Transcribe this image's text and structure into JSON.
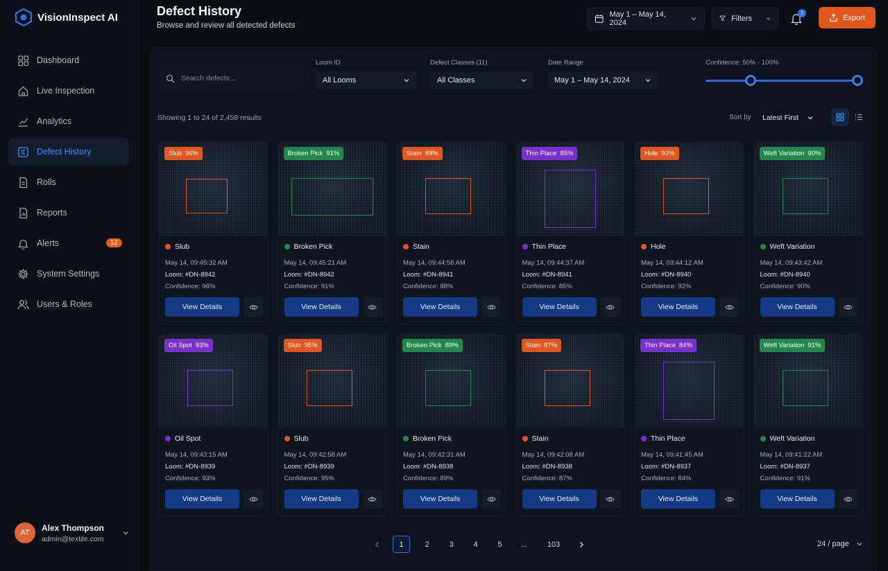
{
  "app": {
    "name": "VisionInspect AI"
  },
  "nav": [
    {
      "label": "Dashboard",
      "icon": "grid-icon"
    },
    {
      "label": "Live Inspection",
      "icon": "home-icon"
    },
    {
      "label": "Analytics",
      "icon": "chart-icon"
    },
    {
      "label": "Defect History",
      "icon": "defect-history-icon",
      "active": true
    },
    {
      "label": "Rolls",
      "icon": "document-icon"
    },
    {
      "label": "Reports",
      "icon": "report-icon"
    },
    {
      "label": "Alerts",
      "icon": "bell-icon",
      "badge": "12"
    },
    {
      "label": "System Settings",
      "icon": "gear-icon"
    },
    {
      "label": "Users & Roles",
      "icon": "users-icon"
    }
  ],
  "user": {
    "initials": "AT",
    "name": "Alex Thompson",
    "email": "admin@textile.com"
  },
  "header": {
    "title": "Defect History",
    "subtitle": "Browse and review all detected defects",
    "date_range": "May 1 – May 14, 2024",
    "filters_label": "Filters",
    "notification_count": "2",
    "export_label": "Export"
  },
  "filters": {
    "search_placeholder": "Search defects...",
    "loom_label": "Loom ID",
    "loom_value": "All Looms",
    "classes_label": "Defect Classes (11)",
    "classes_value": "All Classes",
    "date_label": "Date Range",
    "date_value": "May 1 – May 14, 2024",
    "confidence_label": "Confidence: 50% - 100%",
    "confidence_min": 50,
    "confidence_max": 100
  },
  "results": {
    "showing": "Showing 1 to 24 of 2,458 results",
    "sort_label": "Sort by",
    "sort_value": "Latest First"
  },
  "colors": {
    "orange": "#e5561f",
    "green": "#1f8a4a",
    "purple": "#7b2fd1",
    "accent": "#2f6fe3"
  },
  "cards": [
    {
      "tag": "Slub",
      "pct": "96%",
      "name": "Slub",
      "time": "May 14, 09:45:32 AM",
      "loom": "Loom: #DN-8942",
      "confidence": "Confidence: 96%",
      "color": "orange",
      "box": "small",
      "view": "View Details"
    },
    {
      "tag": "Broken Pick",
      "pct": "91%",
      "name": "Broken Pick",
      "time": "May 14, 09:45:21 AM",
      "loom": "Loom: #DN-8942",
      "confidence": "Confidence: 91%",
      "color": "green",
      "box": "wide",
      "view": "View Details"
    },
    {
      "tag": "Stain",
      "pct": "88%",
      "name": "Stain",
      "time": "May 14, 09:44:58 AM",
      "loom": "Loom: #DN-8941",
      "confidence": "Confidence: 88%",
      "color": "orange",
      "box": "medium",
      "view": "View Details"
    },
    {
      "tag": "Thin Place",
      "pct": "85%",
      "name": "Thin Place",
      "time": "May 14, 09:44:37 AM",
      "loom": "Loom: #DN-8941",
      "confidence": "Confidence: 85%",
      "color": "purple",
      "box": "tall",
      "view": "View Details"
    },
    {
      "tag": "Hole",
      "pct": "92%",
      "name": "Hole",
      "time": "May 14, 09:44:12 AM",
      "loom": "Loom: #DN-8940",
      "confidence": "Confidence: 92%",
      "color": "orange",
      "box": "medium",
      "view": "View Details"
    },
    {
      "tag": "Weft Variation",
      "pct": "90%",
      "name": "Weft Variation",
      "time": "May 14, 09:43:42 AM",
      "loom": "Loom: #DN-8940",
      "confidence": "Confidence: 90%",
      "color": "green",
      "box": "medium",
      "view": "View Details"
    },
    {
      "tag": "Oil Spot",
      "pct": "93%",
      "name": "Oil Spot",
      "time": "May 14, 09:43:15 AM",
      "loom": "Loom: #DN-8939",
      "confidence": "Confidence: 93%",
      "color": "purple",
      "box": "medium",
      "view": "View Details"
    },
    {
      "tag": "Slub",
      "pct": "95%",
      "name": "Slub",
      "time": "May 14, 09:42:58 AM",
      "loom": "Loom: #DN-8939",
      "confidence": "Confidence: 95%",
      "color": "orange",
      "box": "medium",
      "view": "View Details"
    },
    {
      "tag": "Broken Pick",
      "pct": "89%",
      "name": "Broken Pick",
      "time": "May 14, 09:42:31 AM",
      "loom": "Loom: #DN-8938",
      "confidence": "Confidence: 89%",
      "color": "green",
      "box": "medium",
      "view": "View Details"
    },
    {
      "tag": "Stain",
      "pct": "87%",
      "name": "Stain",
      "time": "May 14, 09:42:08 AM",
      "loom": "Loom: #DN-8938",
      "confidence": "Confidence: 87%",
      "color": "orange",
      "box": "medium",
      "view": "View Details"
    },
    {
      "tag": "Thin Place",
      "pct": "84%",
      "name": "Thin Place",
      "time": "May 14, 09:41:45 AM",
      "loom": "Loom: #DN-8937",
      "confidence": "Confidence: 84%",
      "color": "purple",
      "box": "tall",
      "view": "View Details"
    },
    {
      "tag": "Weft Variation",
      "pct": "91%",
      "name": "Weft Variation",
      "time": "May 14, 09:41:22 AM",
      "loom": "Loom: #DN-8937",
      "confidence": "Confidence: 91%",
      "color": "green",
      "box": "medium",
      "view": "View Details"
    }
  ],
  "pagination": {
    "pages": [
      "1",
      "2",
      "3",
      "4",
      "5",
      "...",
      "103"
    ],
    "current": "1",
    "per_page": "24 / page"
  }
}
